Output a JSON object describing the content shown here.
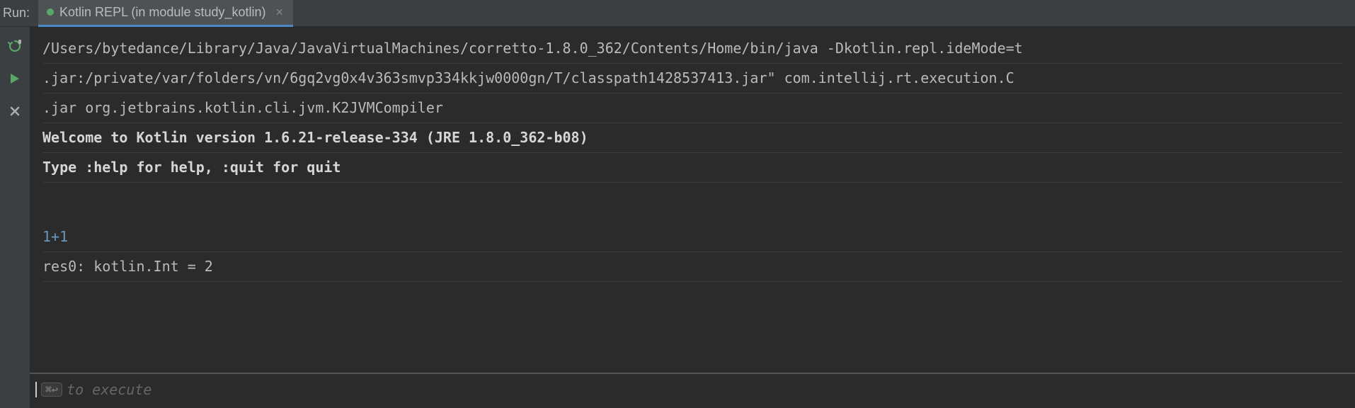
{
  "header": {
    "run_label": "Run:",
    "tab_label": "Kotlin REPL (in module study_kotlin)"
  },
  "console": {
    "lines": [
      "/Users/bytedance/Library/Java/JavaVirtualMachines/corretto-1.8.0_362/Contents/Home/bin/java -Dkotlin.repl.ideMode=t",
      " .jar:/private/var/folders/vn/6gq2vg0x4v363smvp334kkjw0000gn/T/classpath1428537413.jar\" com.intellij.rt.execution.C",
      " .jar org.jetbrains.kotlin.cli.jvm.K2JVMCompiler"
    ],
    "welcome": "Welcome to Kotlin version 1.6.21-release-334 (JRE 1.8.0_362-b08)",
    "help_hint": "Type :help for help, :quit for quit",
    "input_expr": "1+1",
    "result": "res0: kotlin.Int = 2"
  },
  "input": {
    "key_hint": "⌘↩",
    "placeholder": "to execute"
  }
}
